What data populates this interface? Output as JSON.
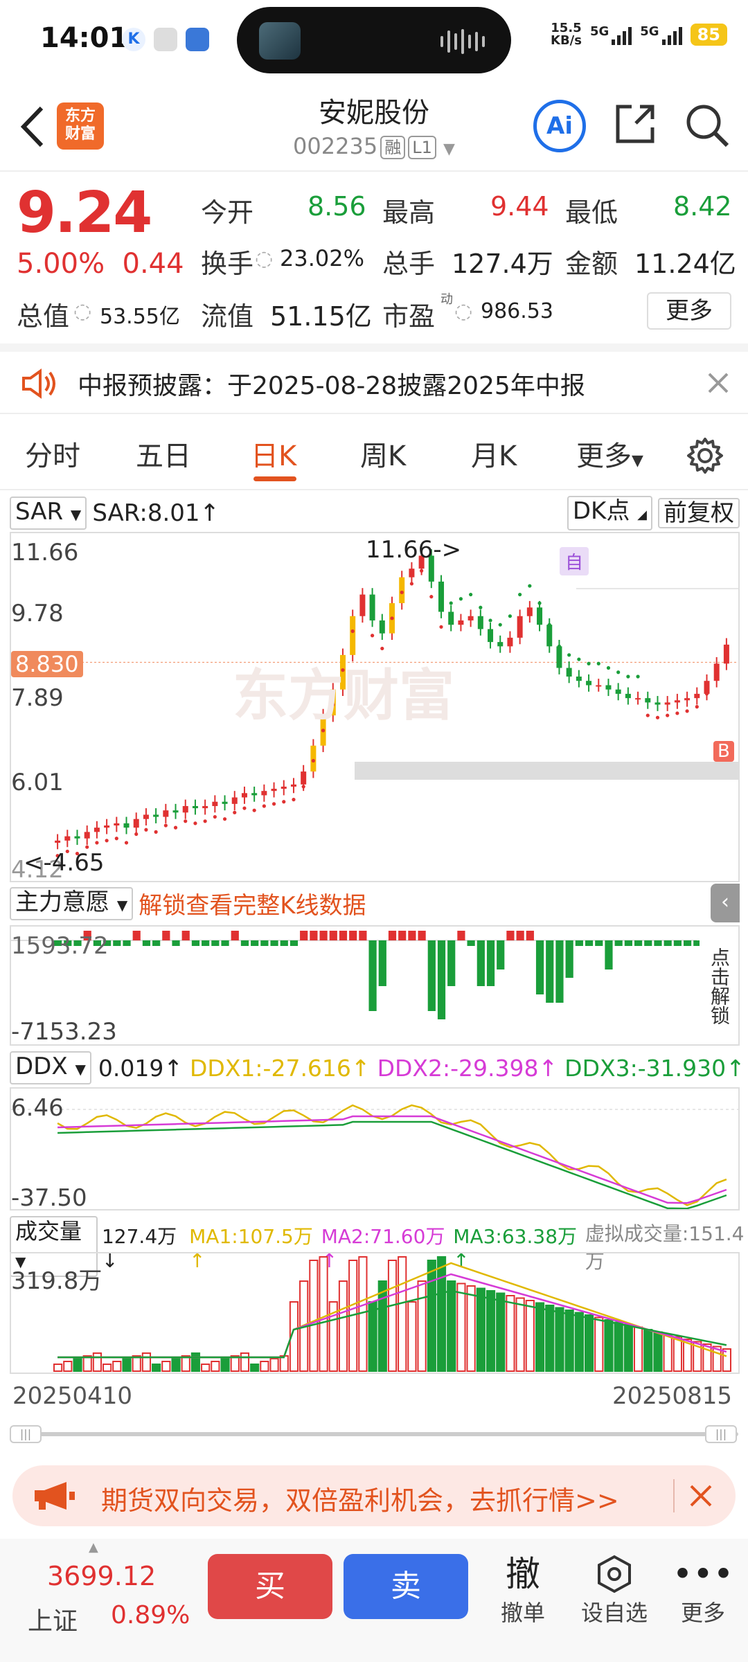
{
  "status_bar": {
    "time": "14:01",
    "net_speed_value": "15.5",
    "net_speed_unit": "KB/s",
    "signal1": "5G",
    "signal2": "5G",
    "battery": "85"
  },
  "header": {
    "logo_line1": "东方",
    "logo_line2": "财富",
    "stock_name": "安妮股份",
    "stock_code": "002235",
    "tag_margin": "融",
    "tag_level": "L1",
    "ai_label": "Ai"
  },
  "quote": {
    "price": "9.24",
    "change_pct": "5.00%",
    "change_amt": "0.44",
    "open_label": "今开",
    "open": "8.56",
    "high_label": "最高",
    "high": "9.44",
    "low_label": "最低",
    "low": "8.42",
    "turnover_label": "换手",
    "turnover": "23.02%",
    "volume_label": "总手",
    "volume": "127.4万",
    "amount_label": "金额",
    "amount": "11.24亿",
    "mktcap_label": "总值",
    "mktcap": "53.55亿",
    "float_label": "流值",
    "float": "51.15亿",
    "pe_label": "市盈",
    "pe_sup": "动",
    "pe": "986.53",
    "more_button": "更多"
  },
  "notice": {
    "text": "中报预披露：于2025-08-28披露2025年中报"
  },
  "tabs": {
    "items": [
      "分时",
      "五日",
      "日K",
      "周K",
      "月K",
      "更多"
    ],
    "active_index": 2
  },
  "kline": {
    "indicator": "SAR",
    "indicator_value": "SAR:8.01",
    "dk_button": "DK点",
    "adjust_button": "前复权",
    "y_labels": [
      "11.66",
      "9.78",
      "7.89",
      "6.01",
      "4.12"
    ],
    "current_price_tag": "8.830",
    "max_annotation": "11.66->",
    "min_annotation": "<-4.65",
    "marker_self": "自",
    "marker_b": "B",
    "watermark": "东方财富"
  },
  "main_force": {
    "label": "主力意愿",
    "unlock_text": "解锁查看完整K线数据",
    "y_top": "1593.72",
    "y_bottom": "-7153.23",
    "side_unlock": "点击解锁"
  },
  "ddx": {
    "label": "DDX",
    "value": "0.019",
    "ddx1": "DDX1:-27.616",
    "ddx2": "DDX2:-29.398",
    "ddx3": "DDX3:-31.930",
    "y_top": "6.46",
    "y_bottom": "-37.50"
  },
  "volume": {
    "label": "成交量",
    "value": "127.4万",
    "ma1": "MA1:107.5万",
    "ma2": "MA2:71.60万",
    "ma3": "MA3:63.38万",
    "virtual": "虚拟成交量:151.4万",
    "y_top": "319.8万",
    "date_start": "20250410",
    "date_end": "20250815"
  },
  "promo": {
    "text": "期货双向交易，双倍盈利机会，去抓行情>>"
  },
  "bottom": {
    "index_value": "3699.12",
    "index_name": "上证",
    "index_change": "0.89%",
    "buy": "买",
    "sell": "卖",
    "cancel_icon_char": "撤",
    "cancel_label": "撤单",
    "watch_label": "设自选",
    "more_label": "更多"
  },
  "colors": {
    "up": "#e03131",
    "down": "#1a9e3a",
    "accent": "#e2531f",
    "ai_blue": "#1f6fe8"
  },
  "chart_data": {
    "type": "candlestick",
    "x_range": [
      "20250410",
      "20250815"
    ],
    "ylim": [
      4.12,
      11.66
    ],
    "close_approx": [
      4.7,
      4.8,
      4.75,
      4.9,
      5.0,
      5.05,
      5.1,
      5.0,
      5.2,
      5.3,
      5.25,
      5.4,
      5.35,
      5.5,
      5.45,
      5.5,
      5.6,
      5.55,
      5.7,
      5.8,
      5.75,
      5.85,
      5.9,
      5.95,
      6.0,
      6.3,
      6.9,
      7.6,
      8.2,
      9.0,
      9.9,
      10.4,
      9.8,
      9.5,
      10.2,
      10.8,
      11.0,
      11.3,
      10.7,
      10.0,
      9.7,
      9.8,
      9.9,
      9.6,
      9.3,
      9.2,
      9.4,
      9.9,
      10.1,
      9.7,
      9.2,
      8.7,
      8.5,
      8.4,
      8.3,
      8.3,
      8.2,
      8.1,
      8.0,
      8.0,
      7.9,
      7.85,
      7.9,
      7.95,
      8.0,
      8.1,
      8.4,
      8.8,
      9.24
    ],
    "annotations": {
      "max": 11.66,
      "min": 4.65,
      "last": 8.83
    }
  }
}
